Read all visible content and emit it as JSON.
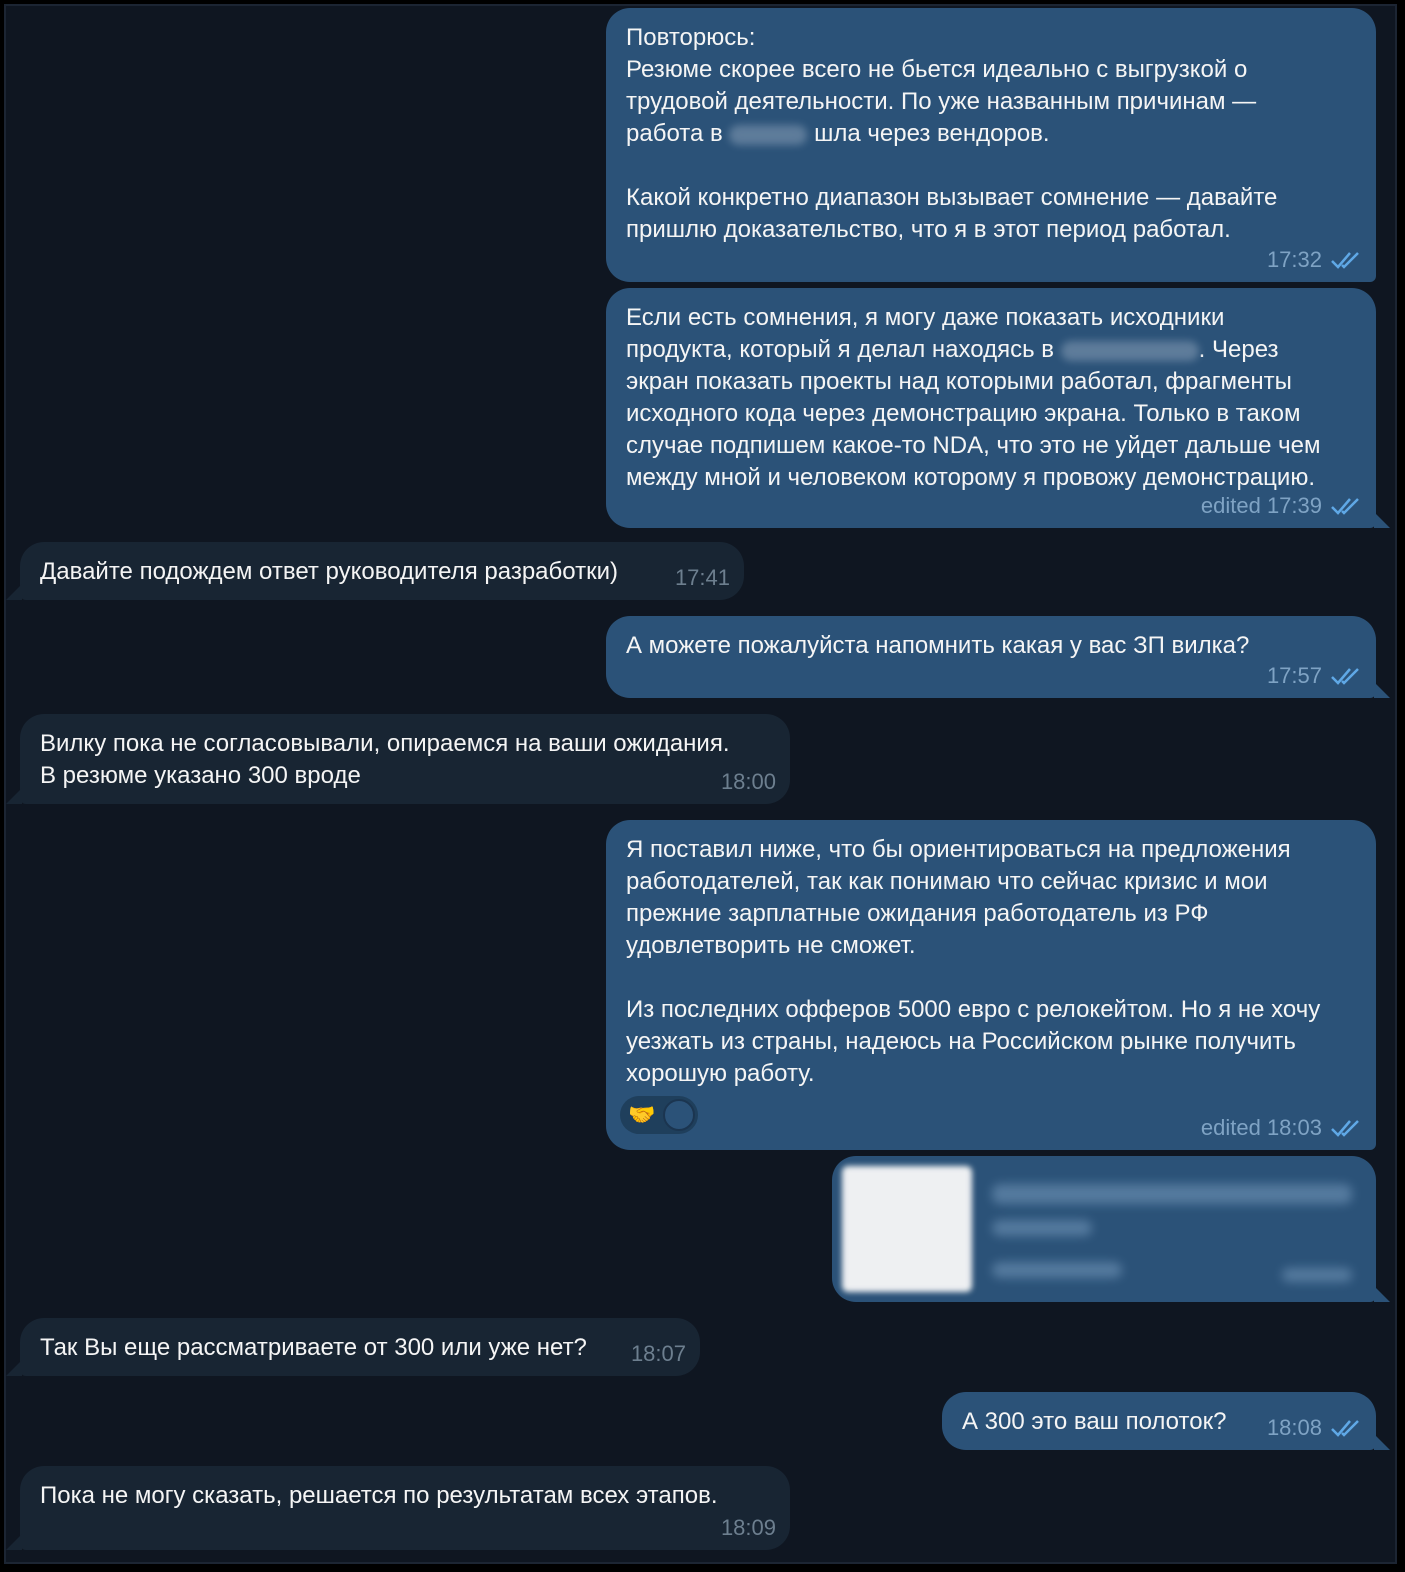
{
  "messages": [
    {
      "id": 1,
      "dir": "out",
      "lines": [
        "Повторюсь:",
        "Резюме скорее всего не бьется идеально с выгрузкой о",
        "трудовой деятельности. По уже названным причинам —",
        "работа в [REDACTED] шла через вендоров.",
        "",
        "Какой конкретно диапазон вызывает сомнение — давайте",
        "пришлю доказательство, что я в этот период работал."
      ],
      "time": "17:32",
      "read": true
    },
    {
      "id": 2,
      "dir": "out",
      "lines": [
        "Если есть сомнения, я могу даже показать исходники",
        "продукта, который я делал находясь в [REDACTED]. Через",
        "экран показать проекты над которыми работал, фрагменты",
        "исходного кода через демонстрацию экрана. Только в таком",
        "случае подпишем какое-то NDA, что это не уйдет дальше чем",
        "между мной и человеком которому я провожу демонстрацию."
      ],
      "time": "edited 17:39",
      "read": true
    },
    {
      "id": 3,
      "dir": "in",
      "text": "Давайте подождем ответ руководителя разработки)",
      "time": "17:41"
    },
    {
      "id": 4,
      "dir": "out",
      "text": "А можете пожалуйста напомнить какая у вас ЗП вилка?",
      "time": "17:57",
      "read": true
    },
    {
      "id": 5,
      "dir": "in",
      "lines": [
        "Вилку пока не согласовывали, опираемся на ваши ожидания.",
        "В резюме указано 300 вроде"
      ],
      "time": "18:00"
    },
    {
      "id": 6,
      "dir": "out",
      "lines": [
        "Я поставил ниже, что бы ориентироваться на предложения",
        "работодателей, так как понимаю что сейчас кризис и мои",
        "прежние зарплатные ожидания работодатель из РФ",
        "удовлетворить не сможет.",
        "",
        "Из последних офферов 5000 евро с релокейтом. Но я не хочу",
        "уезжать из страны, надеюсь на Российском рынке получить",
        "хорошую работу."
      ],
      "time": "edited 18:03",
      "read": true,
      "reaction": "🤝"
    },
    {
      "id": 7,
      "dir": "out",
      "type": "file-redacted"
    },
    {
      "id": 8,
      "dir": "in",
      "text": "Так Вы еще рассматриваете от 300 или уже нет?",
      "time": "18:07"
    },
    {
      "id": 9,
      "dir": "out",
      "text": "А 300 это ваш полоток?",
      "time": "18:08",
      "read": true
    },
    {
      "id": 10,
      "dir": "in",
      "text": "Пока не могу сказать, решается по результатам всех этапов.",
      "time": "18:09"
    }
  ],
  "colors": {
    "outgoing": "#2b5278",
    "incoming": "#182533",
    "background": "#0f1621",
    "check": "#5fa8e6"
  },
  "icons": {
    "read": "double-check-icon",
    "reaction": "handshake-icon"
  }
}
